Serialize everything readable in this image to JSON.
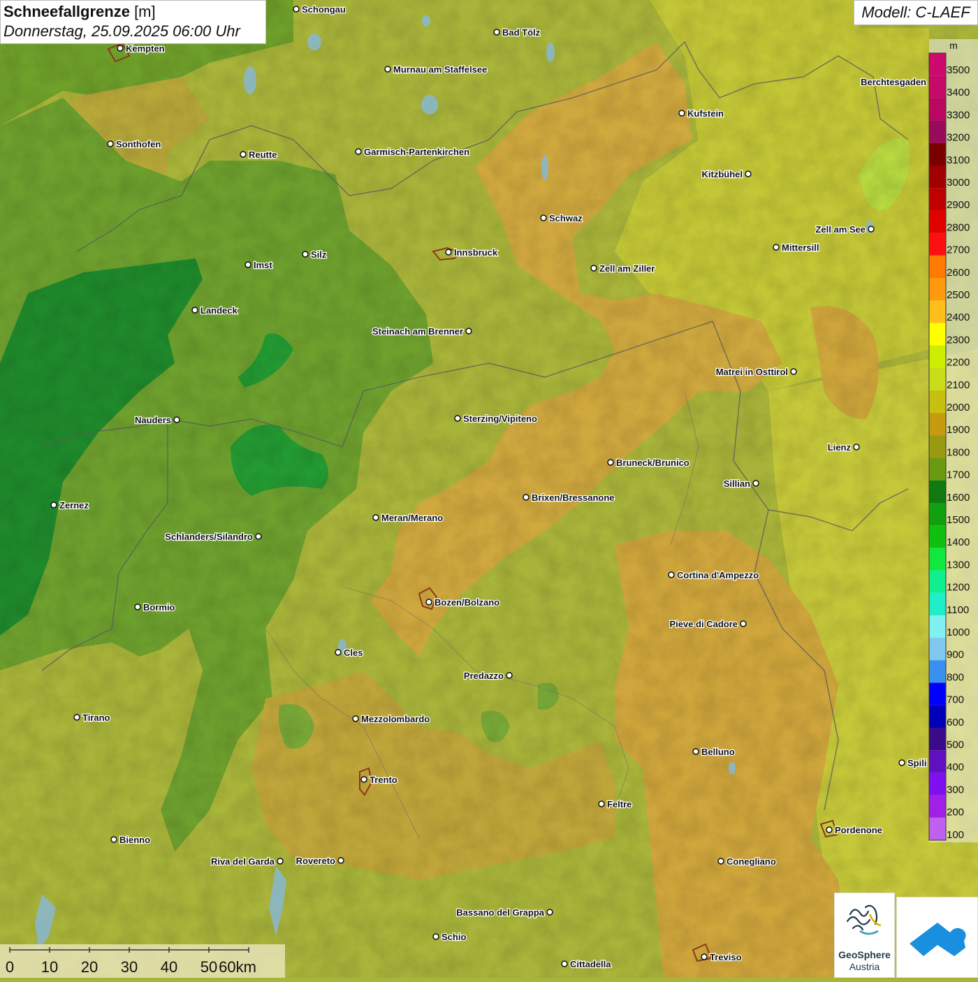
{
  "header": {
    "title_bold": "Schneefallgrenze",
    "title_unit": " [m]",
    "subtitle": "Donnerstag, 25.09.2025 06:00 Uhr"
  },
  "model_label": "Modell: C-LAEF",
  "legend": {
    "unit": "m",
    "levels": [
      {
        "value": "3500",
        "color": "#cc0a6e"
      },
      {
        "value": "3400",
        "color": "#c70a6a"
      },
      {
        "value": "3300",
        "color": "#b80860"
      },
      {
        "value": "3200",
        "color": "#9a0a5a"
      },
      {
        "value": "3100",
        "color": "#7a0000"
      },
      {
        "value": "3000",
        "color": "#a00000"
      },
      {
        "value": "2900",
        "color": "#c00000"
      },
      {
        "value": "2800",
        "color": "#e00000"
      },
      {
        "value": "2700",
        "color": "#ff1010"
      },
      {
        "value": "2600",
        "color": "#ff7a00"
      },
      {
        "value": "2500",
        "color": "#ff9a10"
      },
      {
        "value": "2400",
        "color": "#ffbe1a"
      },
      {
        "value": "2300",
        "color": "#ffff00"
      },
      {
        "value": "2200",
        "color": "#ccee00"
      },
      {
        "value": "2100",
        "color": "#c8dc18"
      },
      {
        "value": "2000",
        "color": "#c8c010"
      },
      {
        "value": "1900",
        "color": "#c89a10"
      },
      {
        "value": "1800",
        "color": "#999a10"
      },
      {
        "value": "1700",
        "color": "#6a9a10"
      },
      {
        "value": "1600",
        "color": "#107a10"
      },
      {
        "value": "1500",
        "color": "#10a010"
      },
      {
        "value": "1400",
        "color": "#10c010"
      },
      {
        "value": "1300",
        "color": "#10e840"
      },
      {
        "value": "1200",
        "color": "#10ee90"
      },
      {
        "value": "1100",
        "color": "#20eec8"
      },
      {
        "value": "1000",
        "color": "#80f0f0"
      },
      {
        "value": "900",
        "color": "#80c8f0"
      },
      {
        "value": "800",
        "color": "#3a90f0"
      },
      {
        "value": "700",
        "color": "#0000ff"
      },
      {
        "value": "600",
        "color": "#0000b8"
      },
      {
        "value": "500",
        "color": "#3a0a8a"
      },
      {
        "value": "400",
        "color": "#6010c0"
      },
      {
        "value": "300",
        "color": "#8010f0"
      },
      {
        "value": "200",
        "color": "#a020e8"
      },
      {
        "value": "100",
        "color": "#c060f0"
      }
    ]
  },
  "scale": {
    "labels": [
      "0",
      "10",
      "20",
      "30",
      "40",
      "50",
      "60km"
    ]
  },
  "logos": {
    "geosphere_line1": "GeoSphere",
    "geosphere_line2": "Austria"
  },
  "cities": [
    {
      "name": "Schongau",
      "label_side": "right"
    },
    {
      "name": "Bad Tölz",
      "label_side": "right"
    },
    {
      "name": "Kempten",
      "label_side": "right"
    },
    {
      "name": "Murnau am Staffelsee",
      "label_side": "right"
    },
    {
      "name": "Berchtesgaden",
      "label_side": "left"
    },
    {
      "name": "Kufstein",
      "label_side": "right"
    },
    {
      "name": "Sonthofen",
      "label_side": "right"
    },
    {
      "name": "Reutte",
      "label_side": "right"
    },
    {
      "name": "Garmisch-Partenkirchen",
      "label_side": "right"
    },
    {
      "name": "Kitzbühel",
      "label_side": "left"
    },
    {
      "name": "Schwaz",
      "label_side": "right"
    },
    {
      "name": "Zell am See",
      "label_side": "left"
    },
    {
      "name": "Innsbruck",
      "label_side": "right"
    },
    {
      "name": "Mittersill",
      "label_side": "right"
    },
    {
      "name": "Imst",
      "label_side": "right"
    },
    {
      "name": "Silz",
      "label_side": "right"
    },
    {
      "name": "Zell am Ziller",
      "label_side": "right"
    },
    {
      "name": "Landeck",
      "label_side": "right"
    },
    {
      "name": "Steinach am Brenner",
      "label_side": "left"
    },
    {
      "name": "Matrei in Osttirol",
      "label_side": "left"
    },
    {
      "name": "Nauders",
      "label_side": "left"
    },
    {
      "name": "Sterzing/Vipiteno",
      "label_side": "right"
    },
    {
      "name": "Lienz",
      "label_side": "left"
    },
    {
      "name": "Bruneck/Brunico",
      "label_side": "right"
    },
    {
      "name": "Sillian",
      "label_side": "left"
    },
    {
      "name": "Brixen/Bressanone",
      "label_side": "right"
    },
    {
      "name": "Zernez",
      "label_side": "right"
    },
    {
      "name": "Meran/Merano",
      "label_side": "right"
    },
    {
      "name": "Schlanders/Silandro",
      "label_side": "left"
    },
    {
      "name": "Cortina d'Ampezzo",
      "label_side": "right"
    },
    {
      "name": "Bozen/Bolzano",
      "label_side": "right"
    },
    {
      "name": "Bormio",
      "label_side": "right"
    },
    {
      "name": "Pieve di Cadore",
      "label_side": "left"
    },
    {
      "name": "Cles",
      "label_side": "right"
    },
    {
      "name": "Predazzo",
      "label_side": "left"
    },
    {
      "name": "Tirano",
      "label_side": "right"
    },
    {
      "name": "Mezzolombardo",
      "label_side": "right"
    },
    {
      "name": "Belluno",
      "label_side": "right"
    },
    {
      "name": "Spili",
      "label_side": "right"
    },
    {
      "name": "Trento",
      "label_side": "right"
    },
    {
      "name": "Feltre",
      "label_side": "right"
    },
    {
      "name": "Bienno",
      "label_side": "right"
    },
    {
      "name": "Pordenone",
      "label_side": "right"
    },
    {
      "name": "Riva del Garda",
      "label_side": "left"
    },
    {
      "name": "Rovereto",
      "label_side": "left"
    },
    {
      "name": "Conegliano",
      "label_side": "right"
    },
    {
      "name": "Bassano del Grappa",
      "label_side": "left"
    },
    {
      "name": "Schio",
      "label_side": "right"
    },
    {
      "name": "Treviso",
      "label_side": "right"
    },
    {
      "name": "Cittadella",
      "label_side": "right"
    }
  ]
}
